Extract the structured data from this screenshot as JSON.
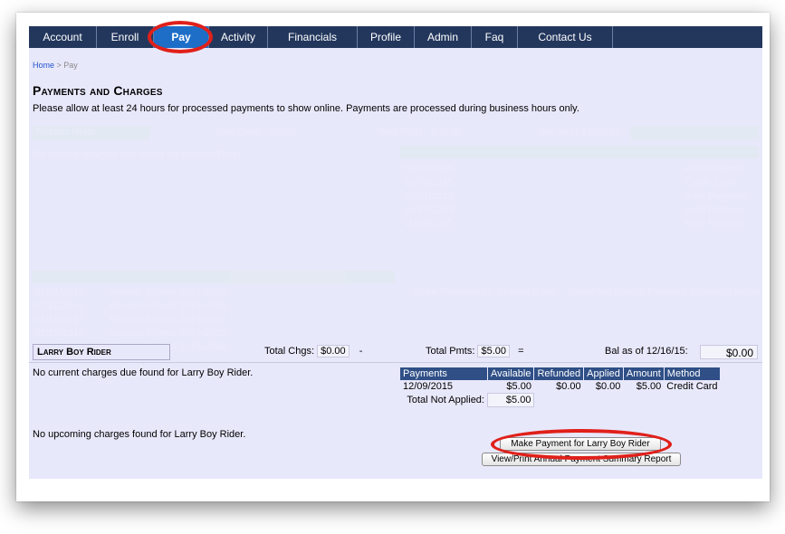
{
  "nav": {
    "tabs": [
      {
        "label": "Account"
      },
      {
        "label": "Enroll"
      },
      {
        "label": "Pay",
        "active": true
      },
      {
        "label": "Activity"
      },
      {
        "label": "Financials"
      },
      {
        "label": "Profile"
      },
      {
        "label": "Admin"
      },
      {
        "label": "Faq"
      },
      {
        "label": "Contact Us"
      }
    ]
  },
  "breadcrumb": {
    "home": "Home",
    "separator": " > ",
    "current": "Pay"
  },
  "page": {
    "title": "Payments and Charges",
    "notice": "Please allow at least 24 hours for processed payments to show online. Payments are processed during business hours only."
  },
  "faded_section": {
    "rider_name": "Bestest Rider",
    "total_chgs_label": "Total Chgs:",
    "total_chgs": "$0.00",
    "total_pmts_label": "Total Pmts:",
    "total_pmts": "$80.00",
    "bal_label": "Bal as of 12/16/15:",
    "no_charges": "No current charges due found for Bestest Rider.",
    "payment_dates": [
      "09/01/2015",
      "10/01/2015",
      "10/01/2015",
      "10/25/2015",
      "11/25/2015"
    ],
    "payment_methods": [
      "Auto Payment",
      "Credit Card",
      "Auto Payment",
      "Auto Payment",
      "Auto Payment"
    ],
    "charge_dates": [
      "01/01/2016",
      "01/11/2016",
      "01/15/2016",
      "01/25/2016",
      "02/01/2016"
    ],
    "charge_descriptions": [
      "Bestest School 2015-2016",
      "Bestest School 2015-2016",
      "Bestest School 2015-2016",
      "Bestest School 2015-2016",
      "Bestest School 2015-2016"
    ],
    "make_payment": "Make Payment for Bestest Rider",
    "view_print": "View/Print Annual Payment Summary Report"
  },
  "rider": {
    "name": "Larry Boy Rider",
    "total_chgs_label": "Total Chgs:",
    "total_chgs": "$0.00",
    "minus": "-",
    "total_pmts_label": "Total Pmts:",
    "total_pmts": "$5.00",
    "equals": "=",
    "bal_label": "Bal as of 12/16/15:",
    "balance": "$0.00",
    "no_current": "No current charges due found for Larry Boy Rider.",
    "no_upcoming": "No upcoming charges found for Larry Boy Rider.",
    "payments_table": {
      "headers": [
        "Payments",
        "Available",
        "Refunded",
        "Applied",
        "Amount",
        "Method"
      ],
      "rows": [
        [
          "12/09/2015",
          "$5.00",
          "$0.00",
          "$0.00",
          "$5.00",
          "Credit Card"
        ]
      ],
      "total_not_applied_label": "Total Not Applied:",
      "total_not_applied": "$5.00"
    },
    "make_payment_button": "Make Payment for Larry Boy Rider",
    "view_print_button": "View/Print Annual Payment Summary Report"
  },
  "colors": {
    "nav_bg": "#23375d",
    "nav_active": "#1e6ec8",
    "page_bg": "#e8e8fb",
    "table_header": "#2f4f86",
    "annotation": "#e0201a"
  }
}
